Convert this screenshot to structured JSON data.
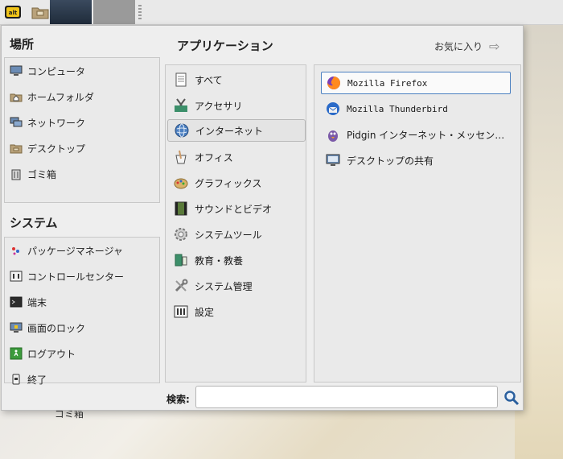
{
  "desktop": {
    "trash_label": "ゴミ箱"
  },
  "panel": {
    "menu_button": "altmenu",
    "folder_button": "folder"
  },
  "places": {
    "heading": "場所",
    "items": [
      {
        "label": "コンピュータ",
        "icon": "computer-icon"
      },
      {
        "label": "ホームフォルダ",
        "icon": "home-folder-icon"
      },
      {
        "label": "ネットワーク",
        "icon": "network-icon"
      },
      {
        "label": "デスクトップ",
        "icon": "desktop-folder-icon"
      },
      {
        "label": "ゴミ箱",
        "icon": "trash-icon"
      }
    ]
  },
  "system": {
    "heading": "システム",
    "items": [
      {
        "label": "パッケージマネージャ",
        "icon": "package-manager-icon"
      },
      {
        "label": "コントロールセンター",
        "icon": "control-center-icon"
      },
      {
        "label": "端末",
        "icon": "terminal-icon"
      },
      {
        "label": "画面のロック",
        "icon": "lock-screen-icon"
      },
      {
        "label": "ログアウト",
        "icon": "logout-icon"
      },
      {
        "label": "終了",
        "icon": "shutdown-icon"
      }
    ]
  },
  "applications": {
    "heading": "アプリケーション",
    "favorites_label": "お気に入り",
    "categories": [
      {
        "label": "すべて",
        "icon": "all-apps-icon"
      },
      {
        "label": "アクセサリ",
        "icon": "accessories-icon"
      },
      {
        "label": "インターネット",
        "icon": "internet-icon",
        "selected": true
      },
      {
        "label": "オフィス",
        "icon": "office-icon"
      },
      {
        "label": "グラフィックス",
        "icon": "graphics-icon"
      },
      {
        "label": "サウンドとビデオ",
        "icon": "sound-video-icon"
      },
      {
        "label": "システムツール",
        "icon": "system-tools-icon"
      },
      {
        "label": "教育・教養",
        "icon": "education-icon"
      },
      {
        "label": "システム管理",
        "icon": "administration-icon"
      },
      {
        "label": "設定",
        "icon": "settings-icon"
      }
    ],
    "apps": [
      {
        "label": "Mozilla Firefox",
        "icon": "firefox-icon",
        "selected": true
      },
      {
        "label": "Mozilla Thunderbird",
        "icon": "thunderbird-icon"
      },
      {
        "label": "Pidgin インターネット・メッセン…",
        "icon": "pidgin-icon"
      },
      {
        "label": "デスクトップの共有",
        "icon": "desktop-sharing-icon"
      }
    ]
  },
  "search": {
    "label": "検索:",
    "value": "",
    "placeholder": ""
  },
  "colors": {
    "selection_border": "#4a7fc0",
    "panel_bg": "#e9e9e9",
    "menu_bg": "#eeeeee"
  }
}
